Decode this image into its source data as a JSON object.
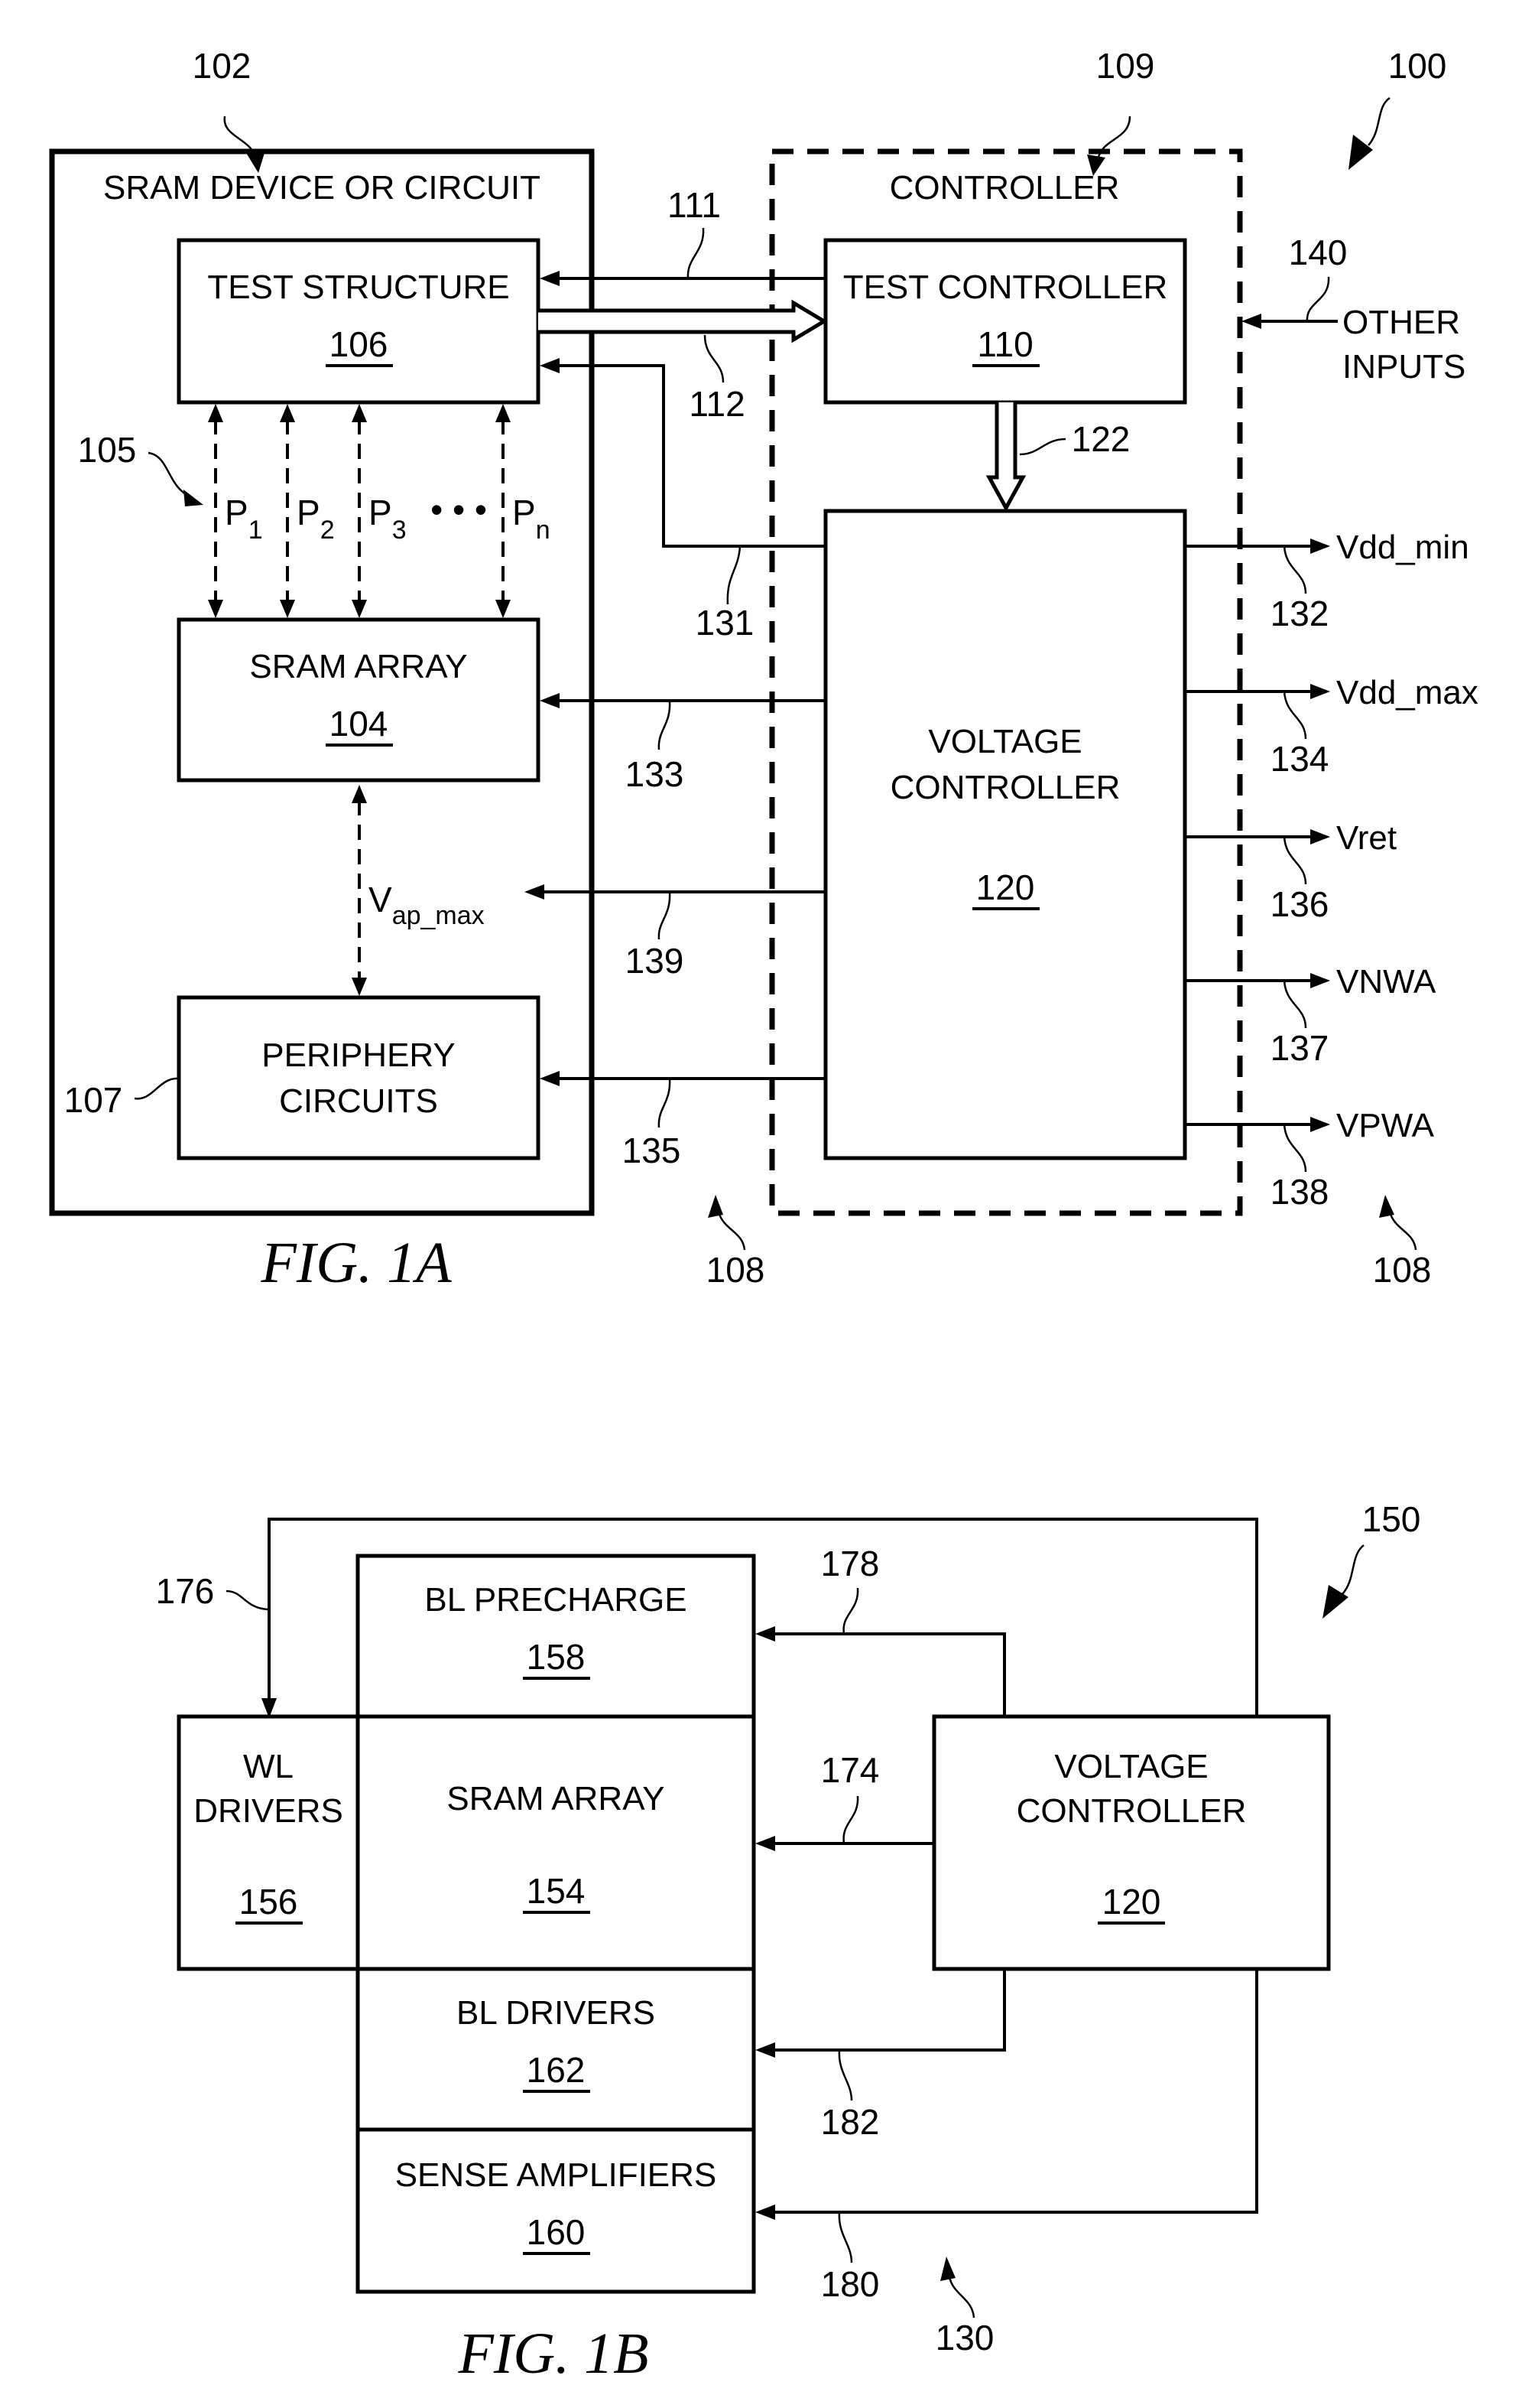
{
  "fig1a": {
    "caption": "FIG. 1A",
    "refs": {
      "r100": "100",
      "r102": "102",
      "r109": "109",
      "r105": "105",
      "r107": "107",
      "r108a": "108",
      "r108b": "108",
      "r111": "111",
      "r112": "112",
      "r122": "122",
      "r131": "131",
      "r132": "132",
      "r133": "133",
      "r134": "134",
      "r135": "135",
      "r136": "136",
      "r137": "137",
      "r138": "138",
      "r139": "139",
      "r140": "140"
    },
    "sram_device": {
      "title": "SRAM DEVICE OR CIRCUIT"
    },
    "test_structure": {
      "title": "TEST STRUCTURE",
      "number": "106"
    },
    "sram_array": {
      "title": "SRAM ARRAY",
      "number": "104"
    },
    "periphery": {
      "line1": "PERIPHERY",
      "line2": "CIRCUITS"
    },
    "controller": {
      "title": "CONTROLLER"
    },
    "test_controller": {
      "title": "TEST CONTROLLER",
      "number": "110"
    },
    "voltage_controller": {
      "line1": "VOLTAGE",
      "line2": "CONTROLLER",
      "number": "120"
    },
    "other_inputs": {
      "line1": "OTHER",
      "line2": "INPUTS"
    },
    "paths": [
      {
        "base": "P",
        "sub": "1"
      },
      {
        "base": "P",
        "sub": "2"
      },
      {
        "base": "P",
        "sub": "3"
      },
      {
        "base": "P",
        "sub": "n"
      }
    ],
    "ellipsis": "• • •",
    "vap": {
      "base": "V",
      "sub": "ap_max"
    },
    "outputs": [
      "Vdd_min",
      "Vdd_max",
      "Vret",
      "VNWA",
      "VPWA"
    ]
  },
  "fig1b": {
    "caption": "FIG. 1B",
    "refs": {
      "r150": "150",
      "r130": "130",
      "r174": "174",
      "r176": "176",
      "r178": "178",
      "r180": "180",
      "r182": "182"
    },
    "bl_precharge": {
      "title": "BL PRECHARGE",
      "number": "158"
    },
    "sram_array": {
      "title": "SRAM ARRAY",
      "number": "154"
    },
    "wl_drivers": {
      "line1": "WL",
      "line2": "DRIVERS",
      "number": "156"
    },
    "bl_drivers": {
      "title": "BL DRIVERS",
      "number": "162"
    },
    "sense_amps": {
      "title": "SENSE AMPLIFIERS",
      "number": "160"
    },
    "voltage_controller": {
      "line1": "VOLTAGE",
      "line2": "CONTROLLER",
      "number": "120"
    }
  }
}
